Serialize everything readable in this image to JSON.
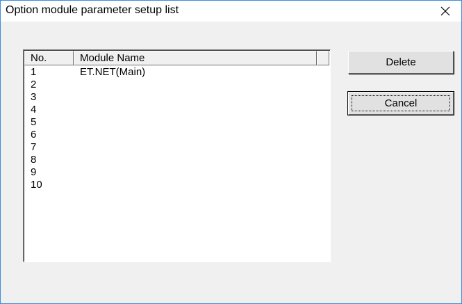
{
  "window": {
    "title": "Option module parameter setup list",
    "close_icon": "close-icon"
  },
  "list": {
    "columns": [
      "No.",
      "Module Name"
    ],
    "rows": [
      {
        "no": "1",
        "name": "ET.NET(Main)"
      },
      {
        "no": "2",
        "name": ""
      },
      {
        "no": "3",
        "name": ""
      },
      {
        "no": "4",
        "name": ""
      },
      {
        "no": "5",
        "name": ""
      },
      {
        "no": "6",
        "name": ""
      },
      {
        "no": "7",
        "name": ""
      },
      {
        "no": "8",
        "name": ""
      },
      {
        "no": "9",
        "name": ""
      },
      {
        "no": "10",
        "name": ""
      }
    ]
  },
  "buttons": {
    "delete": "Delete",
    "cancel": "Cancel"
  },
  "colors": {
    "window_border": "#3c8dd6",
    "dialog_bg": "#f0f0f0"
  }
}
